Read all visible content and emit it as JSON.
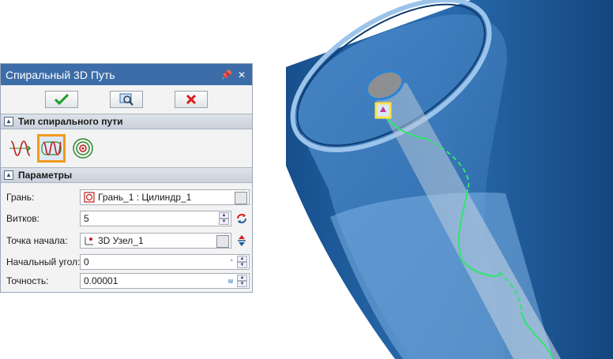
{
  "dialog": {
    "title": "Спиральный 3D Путь",
    "pin_glyph": "↕",
    "close_glyph": "✕"
  },
  "sections": {
    "type": "Тип спирального пути",
    "params": "Параметры"
  },
  "params": {
    "face": {
      "label": "Грань:",
      "value": "Грань_1 : Цилиндр_1"
    },
    "turns": {
      "label": "Витков:",
      "value": "5"
    },
    "start_point": {
      "label": "Точка начала:",
      "value": "3D Узел_1"
    },
    "start_angle": {
      "label": "Начальный угол:",
      "value": "0",
      "unit": "°"
    },
    "accuracy": {
      "label": "Точность:",
      "value": "0.00001",
      "unit": "м"
    }
  },
  "colors": {
    "titlebar": "#3d6da8",
    "pipe_dark": "#1d5c9c",
    "pipe_light": "#5c97d2",
    "helix": "#2ee66b",
    "highlight": "#f19b1c",
    "ok_green": "#1f9e2b",
    "cancel_red": "#d81e1e"
  }
}
